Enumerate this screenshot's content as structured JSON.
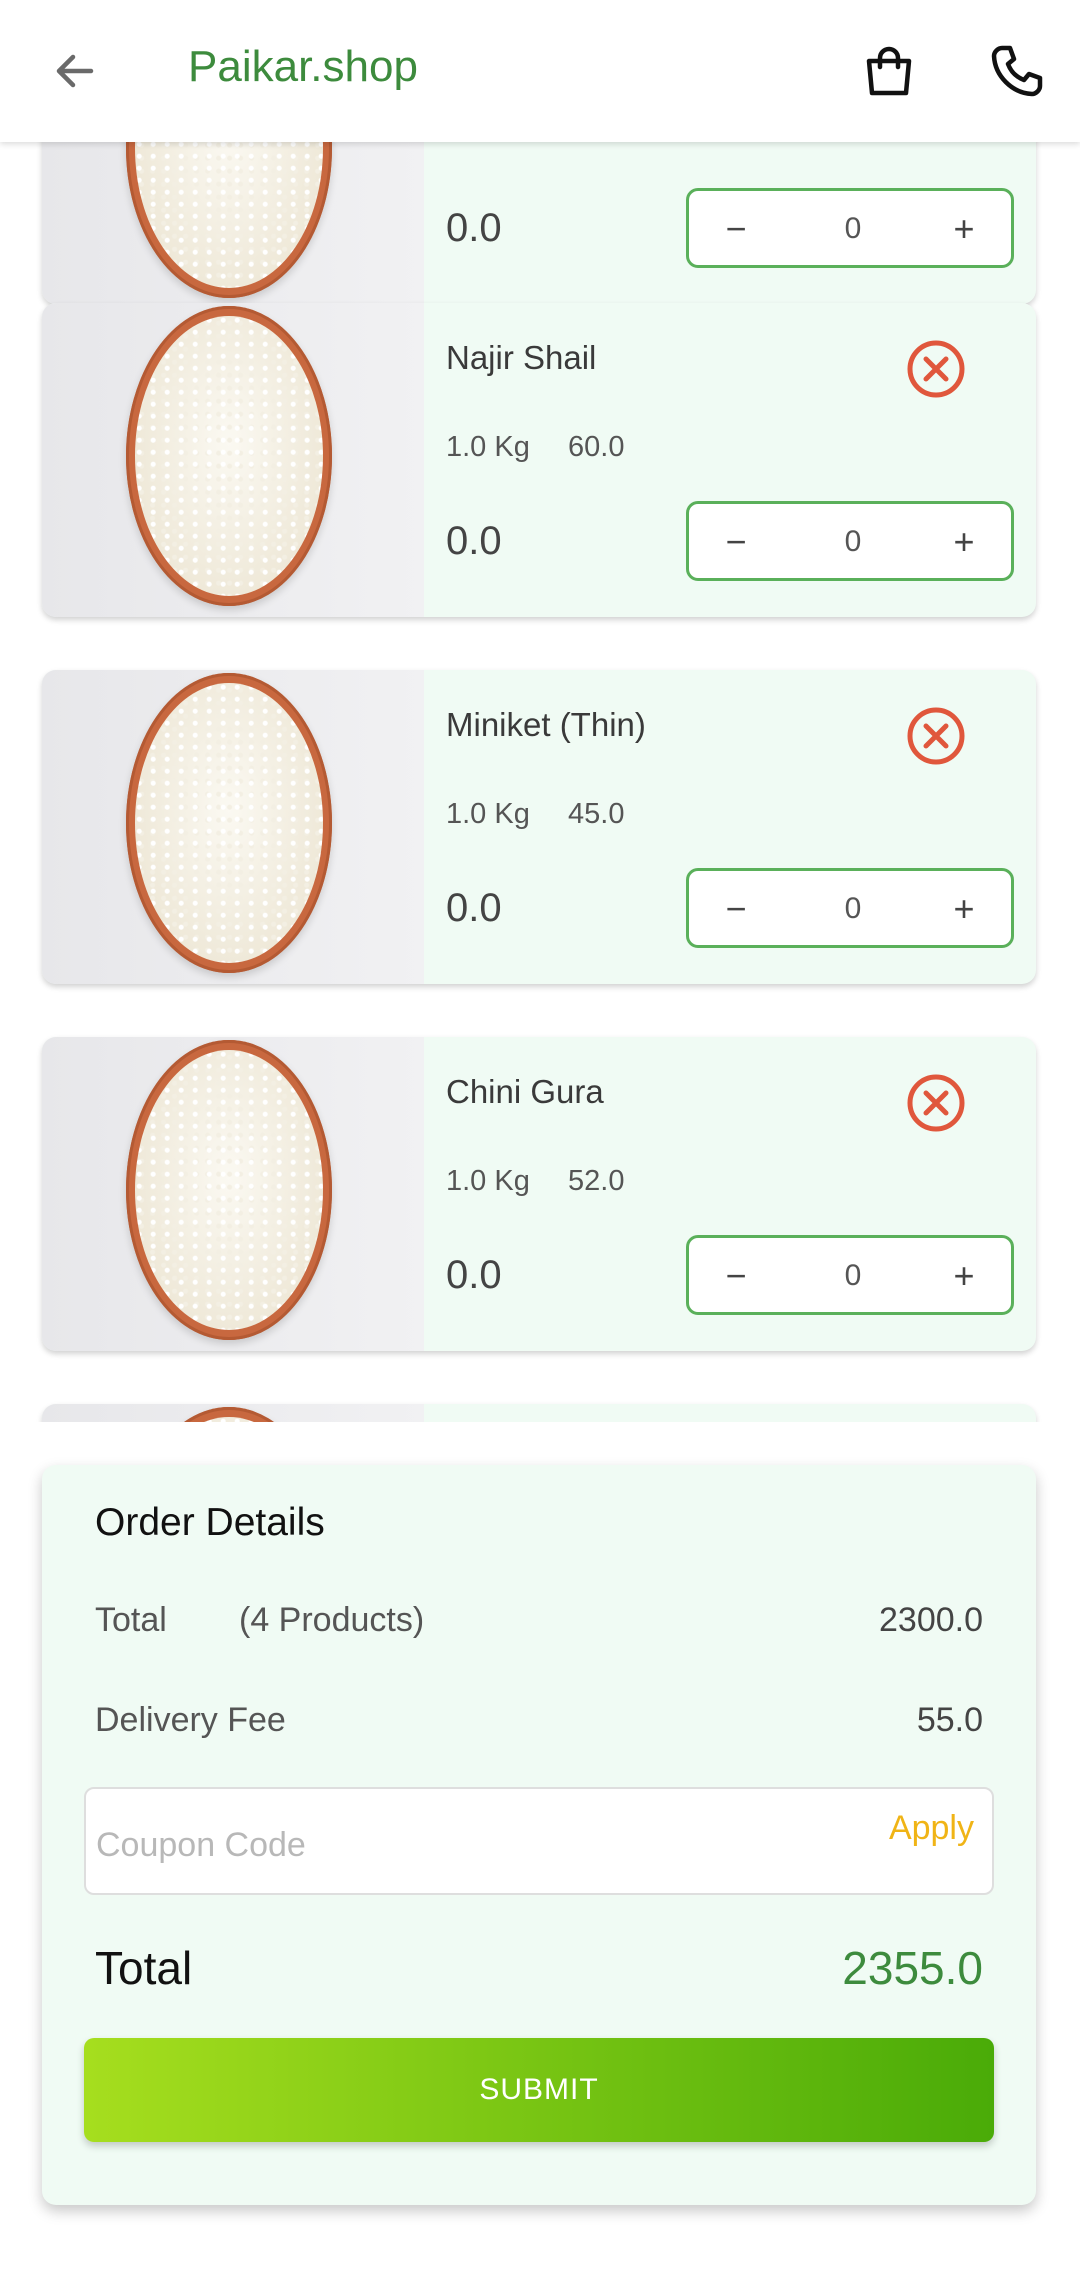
{
  "app_bar": {
    "title": "Paikar.shop",
    "back_icon": "arrow-left-icon",
    "bag_icon": "shopping-bag-icon",
    "phone_icon": "phone-icon"
  },
  "cart_items": [
    {
      "name": "",
      "weight": "",
      "price": "",
      "subtotal": "0.0",
      "qty": "0"
    },
    {
      "name": "Najir Shail",
      "weight": "1.0 Kg",
      "price": "60.0",
      "subtotal": "0.0",
      "qty": "0"
    },
    {
      "name": "Miniket (Thin)",
      "weight": "1.0 Kg",
      "price": "45.0",
      "subtotal": "0.0",
      "qty": "0"
    },
    {
      "name": "Chini Gura",
      "weight": "1.0 Kg",
      "price": "52.0",
      "subtotal": "0.0",
      "qty": "0"
    }
  ],
  "stepper": {
    "minus": "−",
    "plus": "+"
  },
  "order": {
    "heading": "Order Details",
    "total_label": "Total",
    "product_count": "(4 Products)",
    "total_value": "2300.0",
    "delivery_label": "Delivery Fee",
    "delivery_value": "55.0",
    "coupon_placeholder": "Coupon Code",
    "coupon_value": "",
    "apply_label": "Apply",
    "grand_total_label": "Total",
    "grand_total_value": "2355.0",
    "submit_label": "SUBMIT"
  },
  "colors": {
    "brand_green": "#3d8b3d",
    "card_bg": "#f0fbf4",
    "stepper_border": "#5ab05a",
    "remove_red": "#e0573c",
    "apply_yellow": "#f0b416",
    "submit_gradient_start": "#a6de1e",
    "submit_gradient_end": "#4aab08"
  }
}
